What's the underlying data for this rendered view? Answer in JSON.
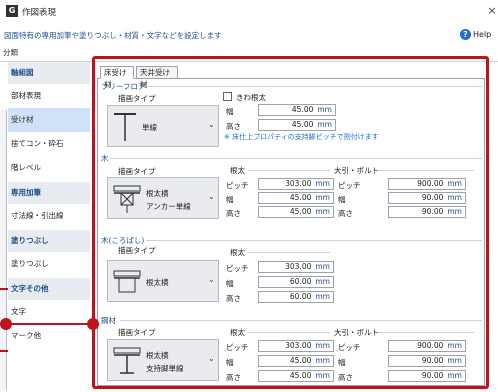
{
  "window": {
    "title": "作図表現",
    "close_label": "×"
  },
  "description": "図面特有の専用加筆や塗りつぶし・材質・文字などを設定します",
  "help_label": "Help",
  "category_label": "分類",
  "sidebar": [
    {
      "type": "head",
      "label": "軸組図"
    },
    {
      "type": "item",
      "label": "部材表現"
    },
    {
      "type": "item",
      "label": "受け材",
      "selected": true
    },
    {
      "type": "item",
      "label": "捨てコン・砕石"
    },
    {
      "type": "item",
      "label": "階レベル"
    },
    {
      "type": "head",
      "label": "専用加筆"
    },
    {
      "type": "item",
      "label": "寸法線・引出線"
    },
    {
      "type": "head",
      "label": "塗りつぶし"
    },
    {
      "type": "item",
      "label": "塗りつぶし"
    },
    {
      "type": "head",
      "label": "文字その他"
    },
    {
      "type": "item",
      "label": "文字"
    },
    {
      "type": "item",
      "label": "マーク他"
    }
  ],
  "tabs": [
    "床受け材",
    "天井受け材"
  ],
  "sections": {
    "free": {
      "title": "フリーフロア",
      "draw_type_label": "描画タイプ",
      "draw_value": "単線",
      "neta_label": "きわ根太",
      "haba_label": "幅",
      "haba": "45.00",
      "takasa_label": "高さ",
      "takasa": "45.00",
      "unit": "mm",
      "note": "※ 床仕上プロパティの支持脚ピッチで割付けます"
    },
    "wood": {
      "title": "木",
      "draw_type_label": "描画タイプ",
      "draw_value1": "根太横",
      "draw_value2": "アンカー単線",
      "neta_group": "根太",
      "obiki_group": "大引・ボルト",
      "pitch_label": "ピッチ",
      "haba_label": "幅",
      "takasa_label": "高さ",
      "neta_pitch": "303.00",
      "neta_haba": "45.00",
      "neta_takasa": "45.00",
      "obiki_pitch": "900.00",
      "obiki_haba": "90.00",
      "obiki_takasa": "90.00",
      "unit": "mm"
    },
    "korobashi": {
      "title": "木(ころばし)",
      "draw_type_label": "描画タイプ",
      "draw_value": "根太横",
      "neta_group": "根太",
      "pitch_label": "ピッチ",
      "haba_label": "幅",
      "takasa_label": "高さ",
      "neta_pitch": "303.00",
      "neta_haba": "60.00",
      "neta_takasa": "60.00",
      "unit": "mm"
    },
    "steel": {
      "title": "鋼材",
      "draw_type_label": "描画タイプ",
      "draw_value1": "根太横",
      "draw_value2": "支持脚単線",
      "neta_group": "根太",
      "obiki_group": "大引・ボルト",
      "pitch_label": "ピッチ",
      "haba_label": "幅",
      "takasa_label": "高さ",
      "neta_pitch": "303.00",
      "neta_haba": "45.00",
      "neta_takasa": "45.00",
      "obiki_pitch": "900.00",
      "obiki_haba": "90.00",
      "obiki_takasa": "90.00",
      "unit": "mm"
    }
  },
  "icons": [
    "app-icon",
    "close-icon",
    "help-icon",
    "chevron-down-icon",
    "checkbox-icon"
  ],
  "colors": {
    "accent": "#1f4f8f",
    "highlight": "#c0121c",
    "selected": "#cfe2f7"
  }
}
